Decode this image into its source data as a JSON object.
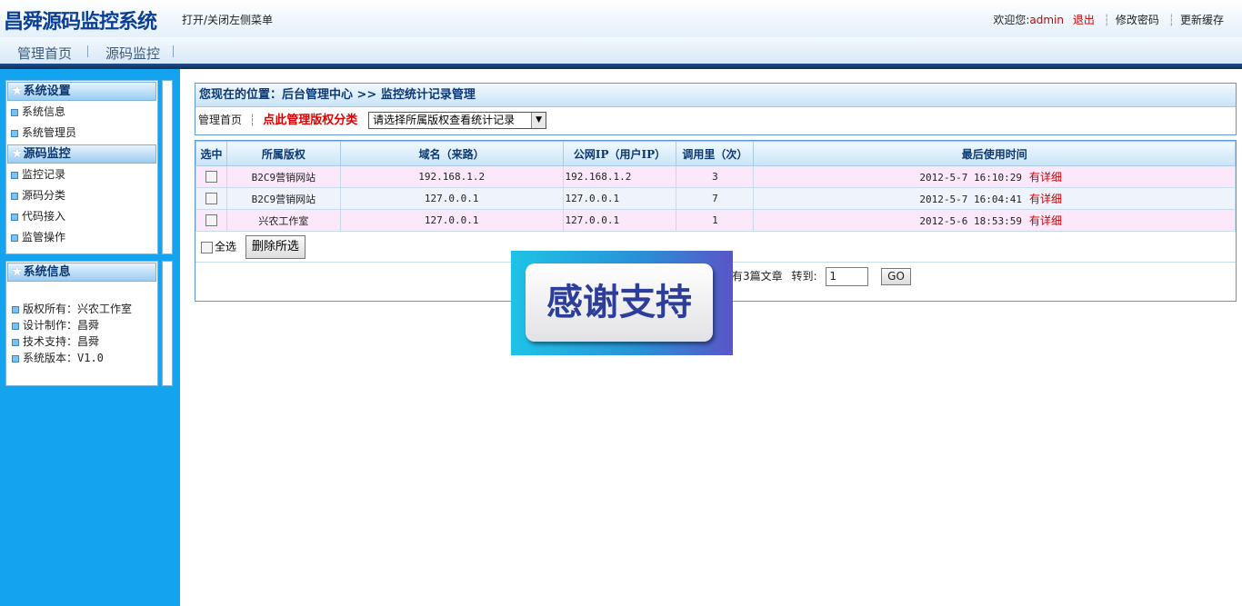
{
  "header": {
    "logo": "昌舜源码监控系统",
    "toggle_menu": "打开/关闭左侧菜单",
    "welcome_label": "欢迎您:",
    "username": "admin",
    "logout": "退出",
    "change_password": "修改密码",
    "update_cache": "更新缓存",
    "separator": "┆"
  },
  "nav": {
    "items": [
      "管理首页",
      "源码监控"
    ]
  },
  "sidebar": {
    "panel1": {
      "sections": [
        {
          "title": "系统设置",
          "items": [
            "系统信息",
            "系统管理员"
          ]
        },
        {
          "title": "源码监控",
          "items": [
            "监控记录",
            "源码分类",
            "代码接入",
            "监管操作"
          ]
        }
      ]
    },
    "panel2": {
      "title": "系统信息",
      "items": [
        "版权所有：兴农工作室",
        "设计制作：昌舜",
        "技术支持：昌舜",
        "系统版本：V1.0"
      ]
    }
  },
  "location": {
    "title": "您现在的位置：后台管理中心 >> 监控统计记录管理",
    "home": "管理首页",
    "sep": "┆",
    "manage_link": "点此管理版权分类",
    "select_value": "请选择所属版权查看统计记录"
  },
  "table": {
    "headers": [
      "选中",
      "所属版权",
      "域名（来路）",
      "公网IP（用户IP）",
      "调用里（次）",
      "最后使用时间"
    ],
    "rows": [
      {
        "owner": "B2C9营销网站",
        "domain": "192.168.1.2",
        "ip": "192.168.1.2",
        "calls": "3",
        "time": "2012-5-7 16:10:29",
        "detail": "有详细"
      },
      {
        "owner": "B2C9营销网站",
        "domain": "127.0.0.1",
        "ip": "127.0.0.1",
        "calls": "7",
        "time": "2012-5-7 16:04:41",
        "detail": "有详细"
      },
      {
        "owner": "兴农工作室",
        "domain": "127.0.0.1",
        "ip": "127.0.0.1",
        "calls": "1",
        "time": "2012-5-6 18:53:59",
        "detail": "有详细"
      }
    ],
    "select_all": "全选",
    "delete_selected": "删除所选"
  },
  "pager": {
    "summary": "有3篇文章",
    "goto_label": "转到:",
    "page_value": "1",
    "go": "GO"
  },
  "overlay": {
    "text": "感谢支持"
  }
}
